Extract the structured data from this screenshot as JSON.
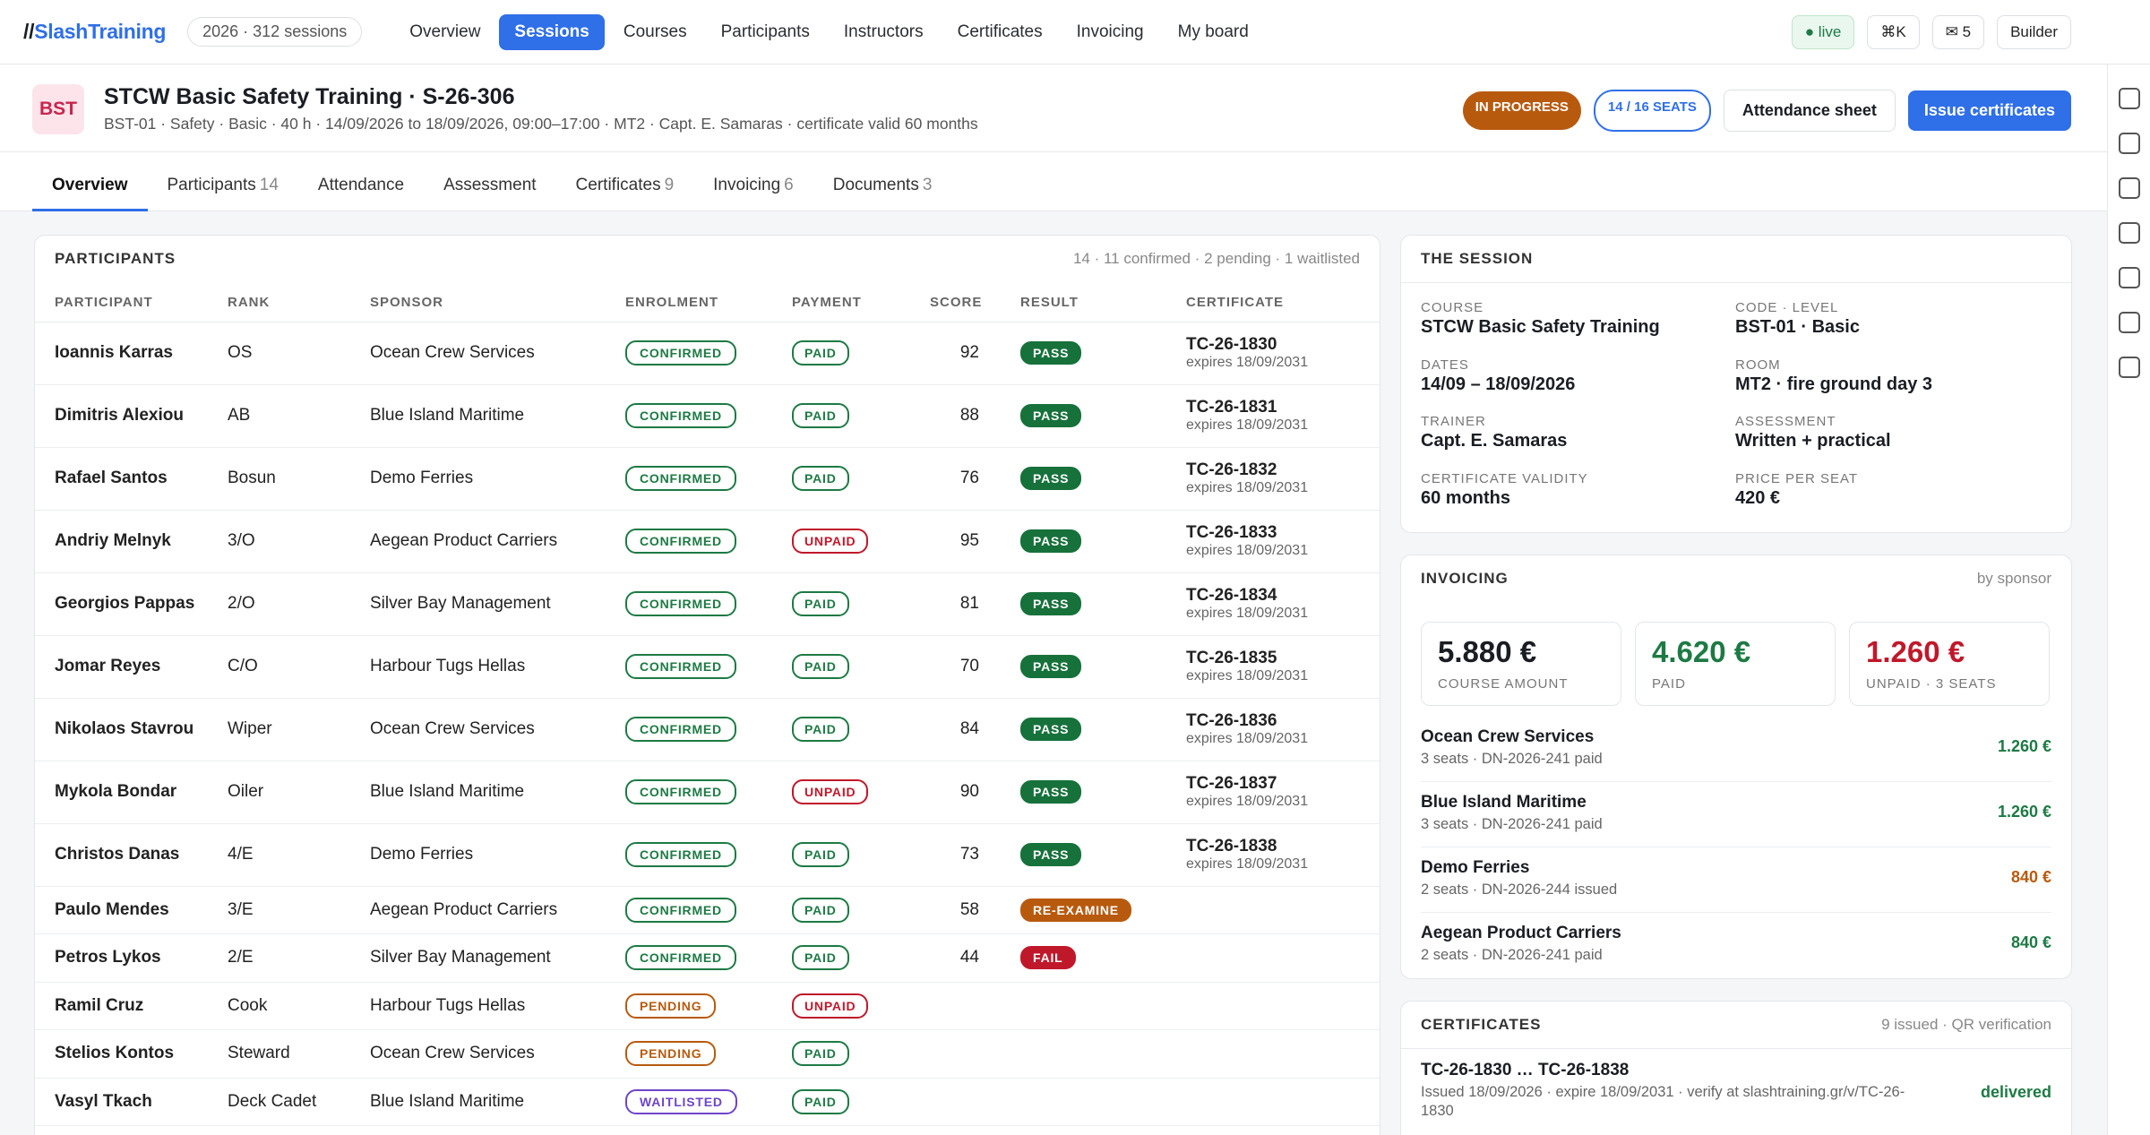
{
  "app": {
    "logo_prefix": "//",
    "logo_brand": "Slash",
    "logo_suffix": "Training",
    "year_pill": "2026 · 312 sessions"
  },
  "nav": {
    "items": [
      "Overview",
      "Sessions",
      "Courses",
      "Participants",
      "Instructors",
      "Certificates",
      "Invoicing",
      "My board"
    ],
    "active": "Sessions"
  },
  "topright": {
    "live": "● live",
    "shortcut": "⌘K",
    "mail": "✉ 5",
    "builder": "Builder"
  },
  "header": {
    "badge": "BST",
    "title": "STCW Basic Safety Training · S-26-306",
    "subtitle": "BST-01 · Safety · Basic · 40 h · 14/09/2026 to 18/09/2026, 09:00–17:00 · MT2 · Capt. E. Samaras · certificate valid 60 months",
    "status": "IN PROGRESS",
    "seats": "14 / 16 SEATS",
    "attendance_btn": "Attendance sheet",
    "issue_btn": "Issue certificates"
  },
  "tabs": [
    {
      "label": "Overview",
      "count": ""
    },
    {
      "label": "Participants",
      "count": "14"
    },
    {
      "label": "Attendance",
      "count": ""
    },
    {
      "label": "Assessment",
      "count": ""
    },
    {
      "label": "Certificates",
      "count": "9"
    },
    {
      "label": "Invoicing",
      "count": "6"
    },
    {
      "label": "Documents",
      "count": "3"
    }
  ],
  "participants": {
    "title": "PARTICIPANTS",
    "meta": "14 · 11 confirmed · 2 pending · 1 waitlisted",
    "columns": [
      "PARTICIPANT",
      "RANK",
      "SPONSOR",
      "ENROLMENT",
      "PAYMENT",
      "SCORE",
      "RESULT",
      "CERTIFICATE"
    ],
    "rows": [
      {
        "name": "Ioannis Karras",
        "rank": "OS",
        "sponsor": "Ocean Crew Services",
        "enrol": "CONFIRMED",
        "pay": "PAID",
        "score": "92",
        "result": "PASS",
        "cert": "TC-26-1830",
        "exp": "expires 18/09/2031"
      },
      {
        "name": "Dimitris Alexiou",
        "rank": "AB",
        "sponsor": "Blue Island Maritime",
        "enrol": "CONFIRMED",
        "pay": "PAID",
        "score": "88",
        "result": "PASS",
        "cert": "TC-26-1831",
        "exp": "expires 18/09/2031"
      },
      {
        "name": "Rafael Santos",
        "rank": "Bosun",
        "sponsor": "Demo Ferries",
        "enrol": "CONFIRMED",
        "pay": "PAID",
        "score": "76",
        "result": "PASS",
        "cert": "TC-26-1832",
        "exp": "expires 18/09/2031"
      },
      {
        "name": "Andriy Melnyk",
        "rank": "3/O",
        "sponsor": "Aegean Product Carriers",
        "enrol": "CONFIRMED",
        "pay": "UNPAID",
        "score": "95",
        "result": "PASS",
        "cert": "TC-26-1833",
        "exp": "expires 18/09/2031"
      },
      {
        "name": "Georgios Pappas",
        "rank": "2/O",
        "sponsor": "Silver Bay Management",
        "enrol": "CONFIRMED",
        "pay": "PAID",
        "score": "81",
        "result": "PASS",
        "cert": "TC-26-1834",
        "exp": "expires 18/09/2031"
      },
      {
        "name": "Jomar Reyes",
        "rank": "C/O",
        "sponsor": "Harbour Tugs Hellas",
        "enrol": "CONFIRMED",
        "pay": "PAID",
        "score": "70",
        "result": "PASS",
        "cert": "TC-26-1835",
        "exp": "expires 18/09/2031"
      },
      {
        "name": "Nikolaos Stavrou",
        "rank": "Wiper",
        "sponsor": "Ocean Crew Services",
        "enrol": "CONFIRMED",
        "pay": "PAID",
        "score": "84",
        "result": "PASS",
        "cert": "TC-26-1836",
        "exp": "expires 18/09/2031"
      },
      {
        "name": "Mykola Bondar",
        "rank": "Oiler",
        "sponsor": "Blue Island Maritime",
        "enrol": "CONFIRMED",
        "pay": "UNPAID",
        "score": "90",
        "result": "PASS",
        "cert": "TC-26-1837",
        "exp": "expires 18/09/2031"
      },
      {
        "name": "Christos Danas",
        "rank": "4/E",
        "sponsor": "Demo Ferries",
        "enrol": "CONFIRMED",
        "pay": "PAID",
        "score": "73",
        "result": "PASS",
        "cert": "TC-26-1838",
        "exp": "expires 18/09/2031"
      },
      {
        "name": "Paulo Mendes",
        "rank": "3/E",
        "sponsor": "Aegean Product Carriers",
        "enrol": "CONFIRMED",
        "pay": "PAID",
        "score": "58",
        "result": "RE-EXAMINE",
        "cert": "",
        "exp": ""
      },
      {
        "name": "Petros Lykos",
        "rank": "2/E",
        "sponsor": "Silver Bay Management",
        "enrol": "CONFIRMED",
        "pay": "PAID",
        "score": "44",
        "result": "FAIL",
        "cert": "",
        "exp": ""
      },
      {
        "name": "Ramil Cruz",
        "rank": "Cook",
        "sponsor": "Harbour Tugs Hellas",
        "enrol": "PENDING",
        "pay": "UNPAID",
        "score": "",
        "result": "",
        "cert": "",
        "exp": ""
      },
      {
        "name": "Stelios Kontos",
        "rank": "Steward",
        "sponsor": "Ocean Crew Services",
        "enrol": "PENDING",
        "pay": "PAID",
        "score": "",
        "result": "",
        "cert": "",
        "exp": ""
      },
      {
        "name": "Vasyl Tkach",
        "rank": "Deck Cadet",
        "sponsor": "Blue Island Maritime",
        "enrol": "WAITLISTED",
        "pay": "PAID",
        "score": "",
        "result": "",
        "cert": "",
        "exp": ""
      }
    ]
  },
  "session": {
    "title": "THE SESSION",
    "fields": [
      {
        "k": "COURSE",
        "v": "STCW Basic Safety Training"
      },
      {
        "k": "CODE · LEVEL",
        "v": "BST-01 · Basic"
      },
      {
        "k": "DATES",
        "v": "14/09 – 18/09/2026"
      },
      {
        "k": "ROOM",
        "v": "MT2 · fire ground day 3"
      },
      {
        "k": "TRAINER",
        "v": "Capt. E. Samaras"
      },
      {
        "k": "ASSESSMENT",
        "v": "Written + practical"
      },
      {
        "k": "CERTIFICATE VALIDITY",
        "v": "60 months"
      },
      {
        "k": "PRICE PER SEAT",
        "v": "420 €"
      }
    ]
  },
  "invoicing": {
    "title": "INVOICING",
    "meta": "by sponsor",
    "cards": [
      {
        "amount": "5.880 €",
        "label": "COURSE AMOUNT"
      },
      {
        "amount": "4.620 €",
        "label": "PAID"
      },
      {
        "amount": "1.260 €",
        "label": "UNPAID · 3 SEATS"
      }
    ],
    "sponsors": [
      {
        "name": "Ocean Crew Services",
        "sub": "3 seats · DN-2026-241 paid",
        "amount": "1.260 €"
      },
      {
        "name": "Blue Island Maritime",
        "sub": "3 seats · DN-2026-241 paid",
        "amount": "1.260 €"
      },
      {
        "name": "Demo Ferries",
        "sub": "2 seats · DN-2026-244 issued",
        "amount": "840 €"
      },
      {
        "name": "Aegean Product Carriers",
        "sub": "2 seats · DN-2026-241 paid",
        "amount": "840 €"
      }
    ]
  },
  "certificates": {
    "title": "CERTIFICATES",
    "meta": "9 issued · QR verification",
    "range": "TC-26-1830 … TC-26-1838",
    "line1": "Issued 18/09/2026 · expire 18/09/2031 · verify at slashtraining.gr/v/TC-26-",
    "line2": "1830",
    "status": "delivered"
  },
  "colors": {
    "accent": "#2f6fe8",
    "green": "#1d7a44",
    "orange": "#b85a0e",
    "red": "#c0182b",
    "purple": "#6d45c9"
  }
}
